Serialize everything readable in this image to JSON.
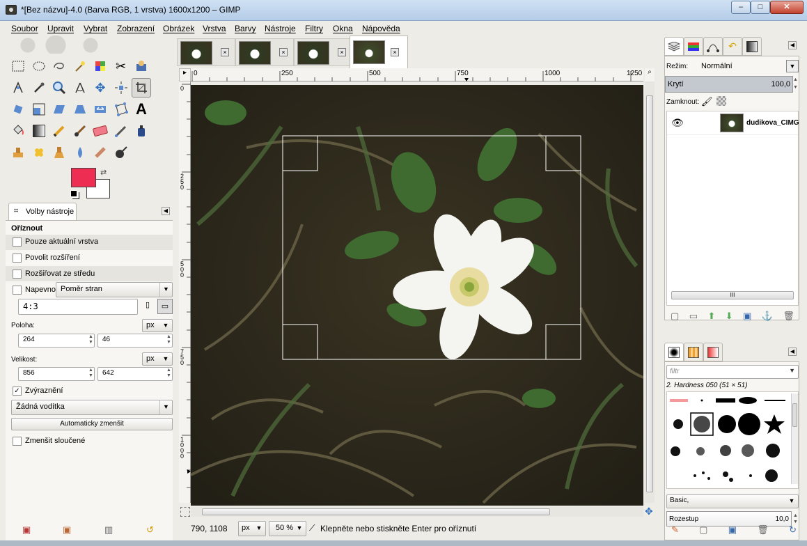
{
  "window": {
    "title": "*[Bez názvu]-4.0 (Barva RGB, 1 vrstva) 1600x1200 – GIMP",
    "minimize": "–",
    "maximize": "□",
    "close": "✕"
  },
  "menu": [
    "Soubor",
    "Upravit",
    "Vybrat",
    "Zobrazení",
    "Obrázek",
    "Vrstva",
    "Barvy",
    "Nástroje",
    "Filtry",
    "Okna",
    "Nápověda"
  ],
  "toolbox": {
    "tools": [
      "rect-select",
      "ellipse-select",
      "free-select",
      "fuzzy-select",
      "select-by-color",
      "scissors",
      "foreground-select",
      "paths",
      "color-picker",
      "zoom",
      "measure",
      "move",
      "align",
      "crop",
      "rotate",
      "scale",
      "shear",
      "perspective",
      "flip",
      "cage",
      "text",
      "bucket-fill",
      "blend",
      "pencil",
      "paintbrush",
      "eraser",
      "airbrush",
      "ink",
      "clone",
      "heal",
      "perspective-clone",
      "blur",
      "smudge",
      "dodge-burn"
    ],
    "fg_color": "#ee2d52",
    "bg_color": "#ffffff"
  },
  "tool_options": {
    "tab_label": "Volby nástroje",
    "title": "Oříznout",
    "only_current_layer": "Pouze aktuální vrstva",
    "allow_growing": "Povolit rozšíření",
    "expand_from_center": "Rozšiřovat ze středu",
    "fixed_label": "Napevno:",
    "fixed_mode": "Poměr stran",
    "ratio": "4:3",
    "position_label": "Poloha:",
    "position_unit": "px",
    "pos_x": "264",
    "pos_y": "46",
    "size_label": "Velikost:",
    "size_unit": "px",
    "size_w": "856",
    "size_h": "642",
    "highlight_label": "Zvýraznění",
    "guides": "Žádná vodítka",
    "autoshrink": "Automaticky zmenšit",
    "shrink_merged": "Zmenšit sloučené"
  },
  "rulers": {
    "h_ticks": [
      "0",
      "250",
      "500",
      "750",
      "1000",
      "1250"
    ],
    "v_ticks": [
      "0",
      "250",
      "500",
      "750",
      "1000"
    ]
  },
  "status": {
    "coords": "790, 1108",
    "unit": "px",
    "zoom": "50 %",
    "message": "Klepněte nebo stiskněte Enter pro oříznutí"
  },
  "layers_dock": {
    "mode_label": "Režim:",
    "mode_value": "Normální",
    "opacity_label": "Krytí",
    "opacity_value": "100,0",
    "lock_label": "Zamknout:",
    "layer_name": "dudikova_CIMG"
  },
  "brushes_dock": {
    "filter_placeholder": "filtr",
    "brush_name": "2. Hardness 050 (51 × 51)",
    "preset": "Basic,",
    "spacing_label": "Rozestup",
    "spacing_value": "10,0"
  }
}
